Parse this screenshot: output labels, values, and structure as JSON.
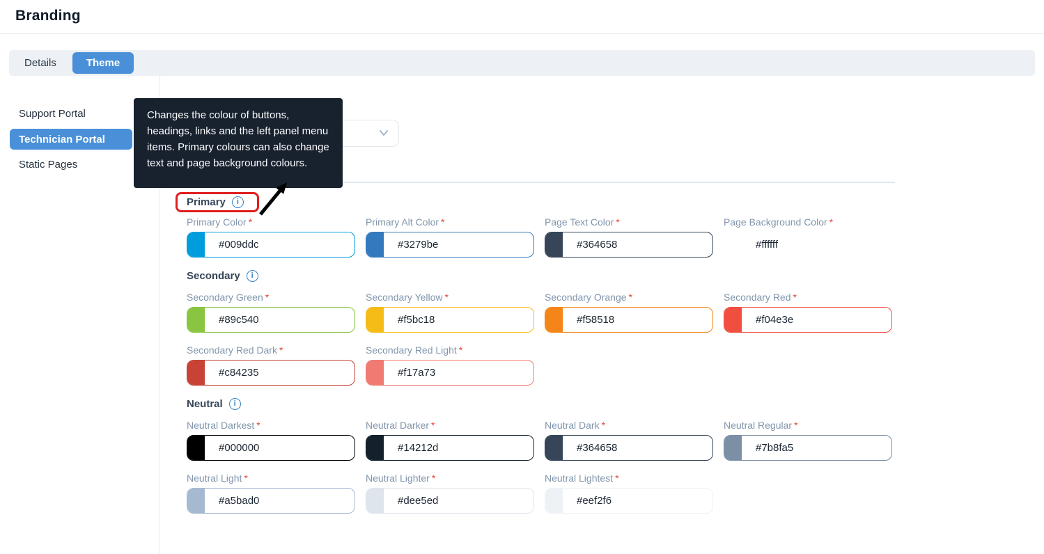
{
  "page_title": "Branding",
  "tabs": [
    {
      "label": "Details",
      "active": false
    },
    {
      "label": "Theme",
      "active": true
    }
  ],
  "sidebar": {
    "items": [
      {
        "label": "Support Portal",
        "active": false
      },
      {
        "label": "Technician Portal",
        "active": true
      },
      {
        "label": "Static Pages",
        "active": false
      }
    ]
  },
  "tooltip": {
    "text": "Changes the colour of buttons, headings, links and the left panel menu items. Primary colours can also change text and page background colours."
  },
  "dropdown": {
    "selected_value": "",
    "icon": "chevron-down-icon"
  },
  "ui": {
    "required_marker": "*",
    "info_icon_glyph": "i"
  },
  "colors": {
    "accent_blue": "#4a90d9",
    "tooltip_bg": "#18222f",
    "annotation_red": "#e01f1f",
    "label_gray_blue": "#8095ac",
    "section_heading": "#364658",
    "info_icon_blue": "#3279be"
  },
  "sections": [
    {
      "name": "Primary",
      "fields": [
        {
          "label": "Primary Color",
          "value": "#009ddc"
        },
        {
          "label": "Primary Alt Color",
          "value": "#3279be"
        },
        {
          "label": "Page Text Color",
          "value": "#364658"
        },
        {
          "label": "Page Background Color",
          "value": "#ffffff"
        }
      ]
    },
    {
      "name": "Secondary",
      "fields": [
        {
          "label": "Secondary Green",
          "value": "#89c540"
        },
        {
          "label": "Secondary Yellow",
          "value": "#f5bc18"
        },
        {
          "label": "Secondary Orange",
          "value": "#f58518"
        },
        {
          "label": "Secondary Red",
          "value": "#f04e3e"
        },
        {
          "label": "Secondary Red Dark",
          "value": "#c84235"
        },
        {
          "label": "Secondary Red Light",
          "value": "#f17a73"
        }
      ]
    },
    {
      "name": "Neutral",
      "fields": [
        {
          "label": "Neutral Darkest",
          "value": "#000000"
        },
        {
          "label": "Neutral Darker",
          "value": "#14212d"
        },
        {
          "label": "Neutral Dark",
          "value": "#364658"
        },
        {
          "label": "Neutral Regular",
          "value": "#7b8fa5"
        },
        {
          "label": "Neutral Light",
          "value": "#a5bad0"
        },
        {
          "label": "Neutral Lighter",
          "value": "#dee5ed"
        },
        {
          "label": "Neutral Lightest",
          "value": "#eef2f6"
        }
      ]
    }
  ]
}
